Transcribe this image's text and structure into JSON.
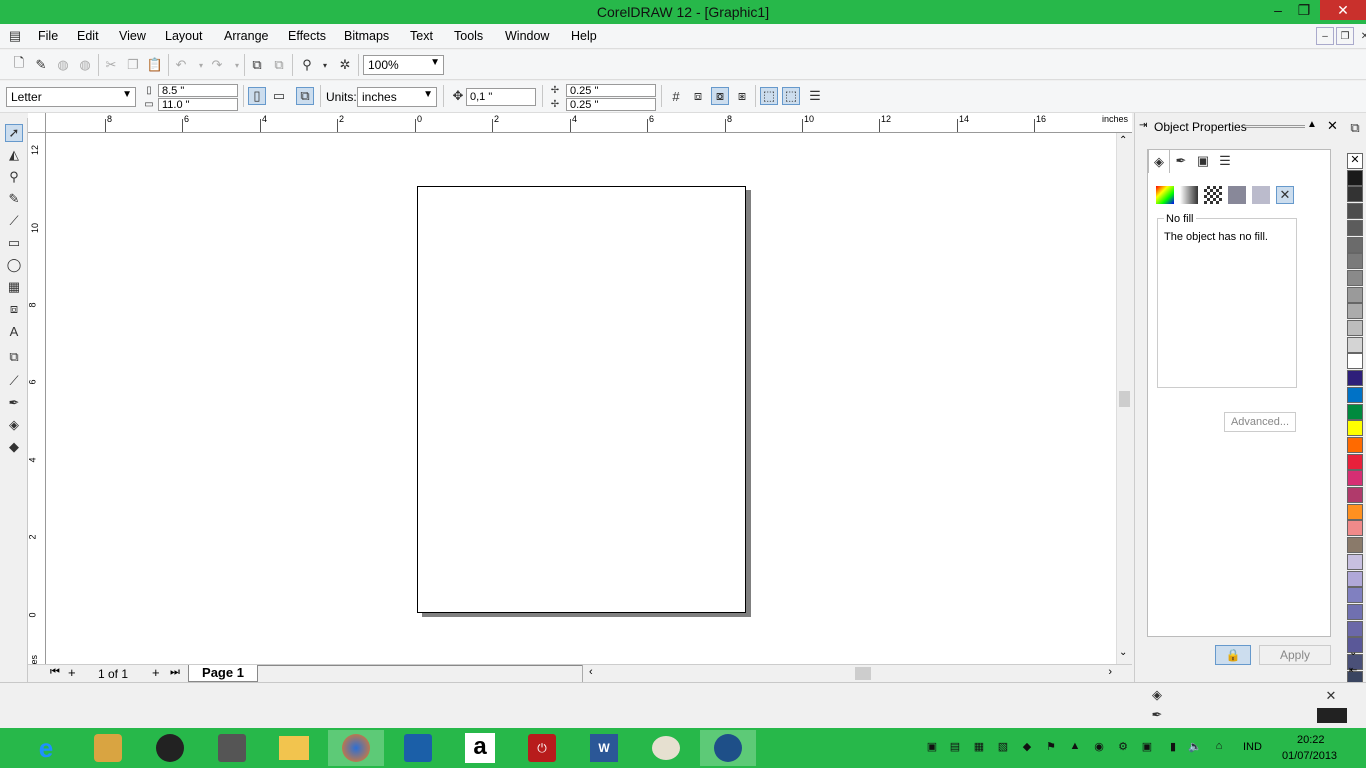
{
  "window": {
    "title": "CorelDRAW 12 - [Graphic1]",
    "minimize": "–",
    "restore": "❐",
    "close": "✕"
  },
  "menu": [
    "File",
    "Edit",
    "View",
    "Layout",
    "Arrange",
    "Effects",
    "Bitmaps",
    "Text",
    "Tools",
    "Window",
    "Help"
  ],
  "mdi_controls": {
    "minimize": "–",
    "restore": "❐",
    "close": "✕"
  },
  "standard_toolbar": {
    "zoom": "100%"
  },
  "property_bar": {
    "paper_type": "Letter",
    "width": "8.5 \"",
    "height": "11.0 \"",
    "units_label": "Units:",
    "units": "inches",
    "nudge": "0,1 \"",
    "dup_x": "0.25 \"",
    "dup_y": "0.25 \""
  },
  "ruler": {
    "unit_label": "inches",
    "h_ticks": [
      "8",
      "6",
      "4",
      "2",
      "0",
      "2",
      "4",
      "6",
      "8",
      "10",
      "12",
      "14",
      "16"
    ],
    "v_ticks": [
      "12",
      "10",
      "8",
      "6",
      "4",
      "2",
      "0"
    ],
    "v_unit": "inches"
  },
  "page_nav": {
    "count": "1 of 1",
    "tab": "Page 1"
  },
  "docker": {
    "title": "Object Properties",
    "group_label": "No fill",
    "description": "The object has no fill.",
    "advanced_button": "Advanced...",
    "apply_button": "Apply"
  },
  "palette_colors": [
    "#ffffff",
    "#1a1a1a",
    "#333333",
    "#4d4d4d",
    "#5c5c5c",
    "#6b6b6b",
    "#7a7a7a",
    "#8a8a8a",
    "#9a9a9a",
    "#ababab",
    "#bdbdbd",
    "#d4d4d4",
    "#ffffff",
    "#2e1f7a",
    "#0072c6",
    "#008a3e",
    "#ffff00",
    "#ff6a00",
    "#e8203b",
    "#d62e73",
    "#b03a6b",
    "#ff9020",
    "#f08a8a",
    "#8a7a6a",
    "#c8c0e0",
    "#b0a8d8",
    "#8080c0",
    "#7070b0",
    "#6b68a8",
    "#5a5898",
    "#4a5078",
    "#3a4560"
  ],
  "taskbar": {
    "lang": "IND",
    "time": "20:22",
    "date": "01/07/2013"
  }
}
